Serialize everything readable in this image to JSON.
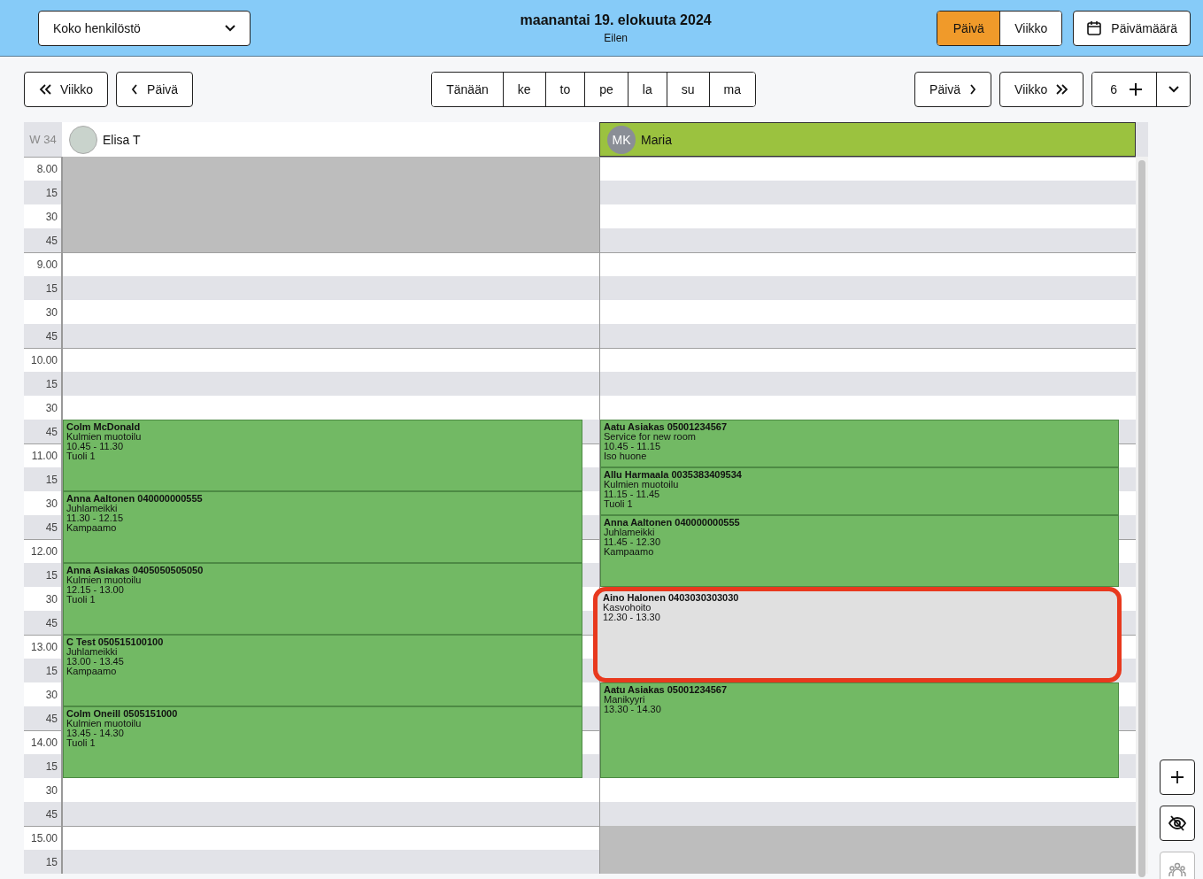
{
  "header": {
    "staff_filter": "Koko henkilöstö",
    "date_title": "maanantai 19. elokuuta 2024",
    "relative_day": "Eilen",
    "view_toggle": [
      {
        "label": "Päivä",
        "selected": true
      },
      {
        "label": "Viikko",
        "selected": false
      }
    ],
    "date_button": "Päivämäärä"
  },
  "toolbar": {
    "back_buttons": [
      {
        "label": "Viikko",
        "kind": "week"
      },
      {
        "label": "Päivä",
        "kind": "day"
      }
    ],
    "day_tabs": [
      "Tänään",
      "ke",
      "to",
      "pe",
      "la",
      "su",
      "ma"
    ],
    "forward_buttons": [
      {
        "label": "Päivä",
        "kind": "day"
      },
      {
        "label": "Viikko",
        "kind": "week"
      }
    ],
    "count_button": "6"
  },
  "calendar": {
    "week_label": "W 34",
    "staff": [
      {
        "name": "Elisa T",
        "kind": "photo",
        "selected": false,
        "appointments": [
          {
            "client": "Colm McDonald",
            "service": "Kulmien muotoilu",
            "time": "10.45 - 11.30",
            "resource": "Tuoli 1",
            "highlighted": false
          },
          {
            "client": "Anna Aaltonen 040000000555",
            "service": "Juhlameikki",
            "time": "11.30 - 12.15",
            "resource": "Kampaamo",
            "highlighted": false
          },
          {
            "client": "Anna Asiakas 0405050505050",
            "service": "Kulmien muotoilu",
            "time": "12.15 - 13.00",
            "resource": "Tuoli 1",
            "highlighted": false
          },
          {
            "client": "C Test 050515100100",
            "service": "Juhlameikki",
            "time": "13.00 - 13.45",
            "resource": "Kampaamo",
            "highlighted": false
          },
          {
            "client": "Colm Oneill 0505151000",
            "service": "Kulmien muotoilu",
            "time": "13.45 - 14.30",
            "resource": "Tuoli 1",
            "highlighted": false
          }
        ]
      },
      {
        "name": "Maria",
        "kind": "initials",
        "initials": "MK",
        "selected": true,
        "appointments": [
          {
            "client": "Aatu Asiakas 05001234567",
            "service": "Service for new room",
            "time": "10.45 - 11.15",
            "resource": "Iso huone",
            "highlighted": false
          },
          {
            "client": "Allu Harmaala 0035383409534",
            "service": "Kulmien muotoilu",
            "time": "11.15 - 11.45",
            "resource": "Tuoli 1",
            "highlighted": false
          },
          {
            "client": "Anna Aaltonen 040000000555",
            "service": "Juhlameikki",
            "time": "11.45 - 12.30",
            "resource": "Kampaamo",
            "highlighted": false
          },
          {
            "client": "Aino Halonen 0403030303030",
            "service": "Kasvohoito",
            "time": "12.30 - 13.30",
            "highlighted": true
          },
          {
            "client": "Aatu Asiakas 05001234567",
            "service": "Manikyyri",
            "time": "13.30 - 14.30",
            "highlighted": false
          }
        ]
      }
    ],
    "slots": [
      {
        "label": "8.00",
        "hour": true,
        "closed": [
          true,
          false
        ]
      },
      {
        "label": "15",
        "hour": false,
        "closed": [
          true,
          false
        ]
      },
      {
        "label": "30",
        "hour": false,
        "closed": [
          true,
          false
        ]
      },
      {
        "label": "45",
        "hour": false,
        "closed": [
          true,
          false
        ]
      },
      {
        "label": "9.00",
        "hour": true,
        "closed": [
          false,
          false
        ]
      },
      {
        "label": "15",
        "hour": false,
        "closed": [
          false,
          false
        ]
      },
      {
        "label": "30",
        "hour": false,
        "closed": [
          false,
          false
        ]
      },
      {
        "label": "45",
        "hour": false,
        "closed": [
          false,
          false
        ]
      },
      {
        "label": "10.00",
        "hour": true,
        "closed": [
          false,
          false
        ]
      },
      {
        "label": "15",
        "hour": false,
        "closed": [
          false,
          false
        ]
      },
      {
        "label": "30",
        "hour": false,
        "closed": [
          false,
          false
        ]
      },
      {
        "label": "45",
        "hour": false,
        "closed": [
          false,
          false
        ]
      },
      {
        "label": "11.00",
        "hour": true,
        "closed": [
          false,
          false
        ]
      },
      {
        "label": "15",
        "hour": false,
        "closed": [
          false,
          false
        ]
      },
      {
        "label": "30",
        "hour": false,
        "closed": [
          false,
          false
        ]
      },
      {
        "label": "45",
        "hour": false,
        "closed": [
          false,
          false
        ]
      },
      {
        "label": "12.00",
        "hour": true,
        "closed": [
          false,
          false
        ]
      },
      {
        "label": "15",
        "hour": false,
        "closed": [
          false,
          false
        ]
      },
      {
        "label": "30",
        "hour": false,
        "closed": [
          false,
          false
        ]
      },
      {
        "label": "45",
        "hour": false,
        "closed": [
          false,
          false
        ]
      },
      {
        "label": "13.00",
        "hour": true,
        "closed": [
          false,
          false
        ]
      },
      {
        "label": "15",
        "hour": false,
        "closed": [
          false,
          false
        ]
      },
      {
        "label": "30",
        "hour": false,
        "closed": [
          false,
          false
        ]
      },
      {
        "label": "45",
        "hour": false,
        "closed": [
          false,
          false
        ]
      },
      {
        "label": "14.00",
        "hour": true,
        "closed": [
          false,
          false
        ]
      },
      {
        "label": "15",
        "hour": false,
        "closed": [
          false,
          false
        ]
      },
      {
        "label": "30",
        "hour": false,
        "closed": [
          false,
          false
        ]
      },
      {
        "label": "45",
        "hour": false,
        "closed": [
          false,
          false
        ]
      },
      {
        "label": "15.00",
        "hour": true,
        "closed": [
          false,
          true
        ]
      },
      {
        "label": "15",
        "hour": false,
        "closed": [
          false,
          true
        ]
      }
    ]
  },
  "side_actions": [
    {
      "kind": "add",
      "disabled": false
    },
    {
      "kind": "hide",
      "disabled": false
    },
    {
      "kind": "group",
      "disabled": true
    }
  ]
}
